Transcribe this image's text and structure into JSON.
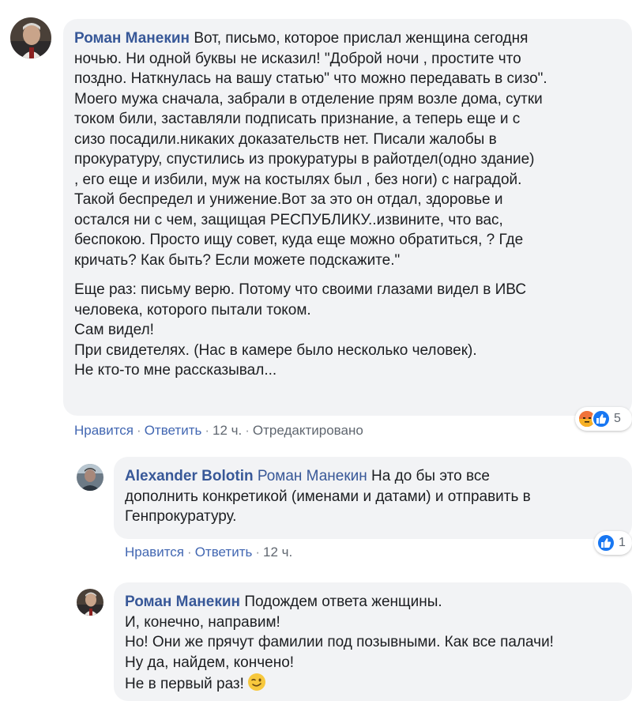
{
  "comments": [
    {
      "author": "Роман Манекин",
      "paragraphs": [
        "Вот, письмо, которое прислал женщина сегодня\nночью. Ни одной буквы не исказил! \"Доброй ночи , простите что\nпоздно. Наткнулась на вашу статью\" что можно передавать в сизо\".\nМоего мужа сначала, забрали в отделение прям возле дома, сутки\nтоком били, заставляли подписать признание, а теперь еще и с\nсизо посадили.никаких доказательств нет. Писали жалобы в\nпрокуратуру, спустились из прокуратуры в райотдел(одно здание)\n, его еще и избили, муж на костылях был , без ноги) с наградой.\nТакой беспредел и унижение.Вот за это он отдал, здоровье и\nостался ни с чем, защищая РЕСПУБЛИКУ..извините, что вас,\nбеспокою. Просто ищу совет, куда еще можно обратиться, ? Где\nкричать? Как быть? Если можете подскажите.\"",
        "Еще раз: письму верю. Потому что своими глазами видел в ИВС\nчеловека, которого пытали током.\nСам видел!\nПри свидетелях. (Нас в камере было несколько человек).\nНе кто-то мне рассказывал..."
      ],
      "like_label": "Нравится",
      "reply_label": "Ответить",
      "time": "12 ч.",
      "edited_label": "Отредактировано",
      "reaction_icons": [
        "angry-reaction-icon",
        "like-reaction-icon"
      ],
      "reaction_count": "5"
    },
    {
      "author": "Alexander Bolotin",
      "mention": "Роман Манекин",
      "text": "На до бы это все\nдополнить конкретикой (именами и датами) и отправить в\nГенпрокуратуру.",
      "like_label": "Нравится",
      "reply_label": "Ответить",
      "time": "12 ч.",
      "reaction_icons": [
        "like-reaction-icon"
      ],
      "reaction_count": "1"
    },
    {
      "author": "Роман Манекин",
      "text": "Подождем ответа женщины.\nИ, конечно, направим!\nНо! Они же прячут фамилии под позывными. Как все палачи!\nНу да, найдем, кончено!\nНе в первый раз!",
      "emoji": "wink-emoji-icon"
    }
  ],
  "colors": {
    "link": "#385898",
    "action_link": "#4267b2",
    "bubble": "#f2f3f5",
    "like_blue": "#1877f2",
    "angry_orange": "#f0733a"
  }
}
